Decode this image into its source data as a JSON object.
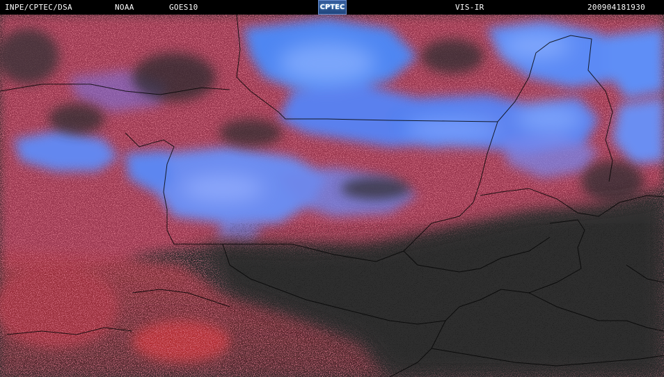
{
  "header": {
    "agency": "INPE/CPTEC/DSA",
    "provider": "NOAA",
    "satellite": "GOES10",
    "channel": "VIS-IR",
    "timestamp": "200904181930",
    "logo_text": "CPTEC"
  },
  "colors": {
    "background_land": "#2b2b2b",
    "low_cloud": "#b33545",
    "high_cloud": "#4f7df0",
    "border_line": "#000000"
  }
}
